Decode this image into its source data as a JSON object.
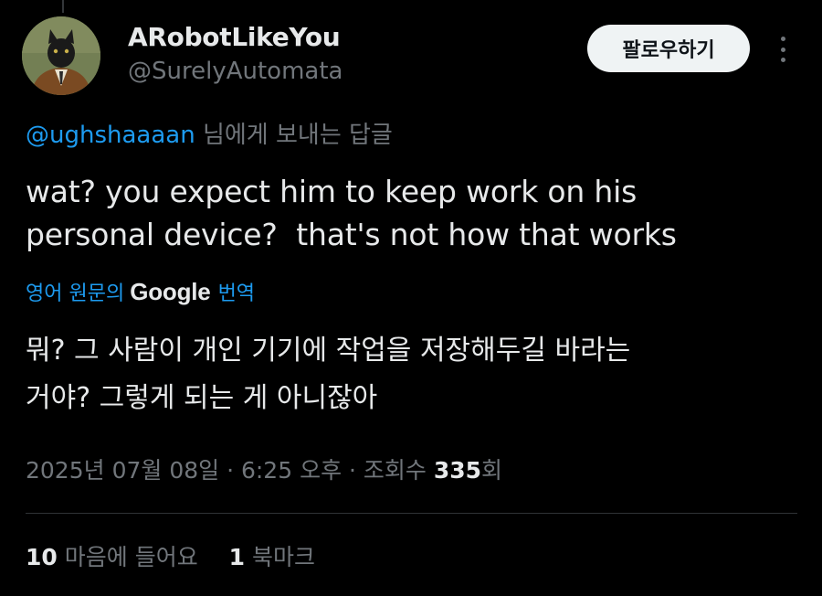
{
  "author": {
    "display_name": "ARobotLikeYou",
    "handle": "@SurelyAutomata",
    "avatar_icon": "cat-in-suit-portrait-avatar"
  },
  "actions": {
    "follow_label": "팔로우하기",
    "more_icon": "more-vertical-icon"
  },
  "reply_to": {
    "mention": "@ughshaaaan",
    "suffix": " 님에게 보내는 답글"
  },
  "tweet": {
    "text": "wat? you expect him to keep work on his\npersonal device?  that's not how that works",
    "translate_prefix": "영어 원문의",
    "translate_brand": "Google",
    "translate_suffix": "번역",
    "translated_text": "뭐? 그 사람이 개인 기기에 작업을 저장해두길 바라는\n거야? 그렇게 되는 게 아니잖아"
  },
  "meta": {
    "datetime": "2025년 07월 08일 · 6:25 오후 · 조회수 ",
    "views": "335",
    "views_suffix": "회"
  },
  "stats": {
    "likes_count": "10",
    "likes_label": " 마음에 들어요",
    "bookmarks_count": "1",
    "bookmarks_label": " 북마크"
  },
  "colors": {
    "background": "#000000",
    "text": "#e7e9ea",
    "muted": "#71767b",
    "accent": "#1d9bf0",
    "follow_button_bg": "#eff3f4"
  }
}
